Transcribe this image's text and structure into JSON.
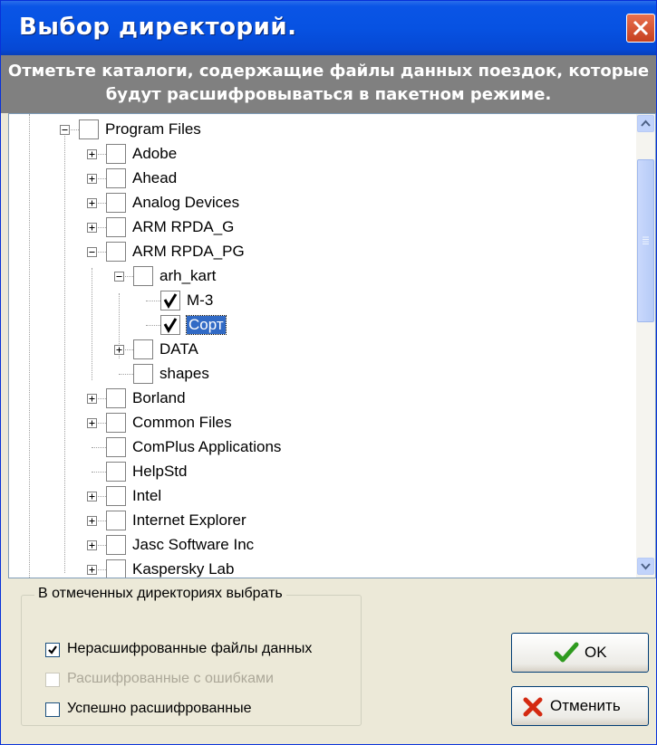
{
  "window": {
    "title": "Выбор директорий.",
    "close_icon": "close-icon"
  },
  "banner": {
    "line1": "Отметьте каталоги, содержащие файлы данных поездок, которые",
    "line2": "будут расшифровываться в пакетном режиме."
  },
  "tree": {
    "items": [
      {
        "label": "Program Files",
        "expander": "minus",
        "checked": false
      },
      {
        "label": "Adobe",
        "expander": "plus",
        "checked": false
      },
      {
        "label": "Ahead",
        "expander": "plus",
        "checked": false
      },
      {
        "label": "Analog Devices",
        "expander": "plus",
        "checked": false
      },
      {
        "label": "ARM RPDA_G",
        "expander": "plus",
        "checked": false
      },
      {
        "label": "ARM RPDA_PG",
        "expander": "minus",
        "checked": false
      },
      {
        "label": "arh_kart",
        "expander": "minus",
        "checked": false
      },
      {
        "label": "М-3",
        "expander": "none",
        "checked": true
      },
      {
        "label": "Сорт",
        "expander": "none",
        "checked": true,
        "selected": true
      },
      {
        "label": "DATA",
        "expander": "plus",
        "checked": false
      },
      {
        "label": "shapes",
        "expander": "none",
        "checked": false
      },
      {
        "label": "Borland",
        "expander": "plus",
        "checked": false
      },
      {
        "label": "Common Files",
        "expander": "plus",
        "checked": false
      },
      {
        "label": "ComPlus Applications",
        "expander": "none",
        "checked": false
      },
      {
        "label": "HelpStd",
        "expander": "none",
        "checked": false
      },
      {
        "label": "Intel",
        "expander": "plus",
        "checked": false
      },
      {
        "label": "Internet Explorer",
        "expander": "plus",
        "checked": false
      },
      {
        "label": "Jasc Software Inc",
        "expander": "plus",
        "checked": false
      },
      {
        "label": "Kaspersky Lab",
        "expander": "plus",
        "checked": false
      }
    ]
  },
  "options": {
    "legend": "В отмеченных директориях выбрать",
    "items": [
      {
        "label": "Нерасшифрованные файлы данных",
        "checked": true,
        "disabled": false
      },
      {
        "label": "Расшифрованные с ошибками",
        "checked": false,
        "disabled": true
      },
      {
        "label": "Успешно расшифрованные",
        "checked": false,
        "disabled": false
      }
    ]
  },
  "buttons": {
    "ok_label": "OK",
    "cancel_label": "Отменить"
  },
  "colors": {
    "titlebar": "#0752E2",
    "selection": "#316AC5",
    "banner": "#808080"
  }
}
